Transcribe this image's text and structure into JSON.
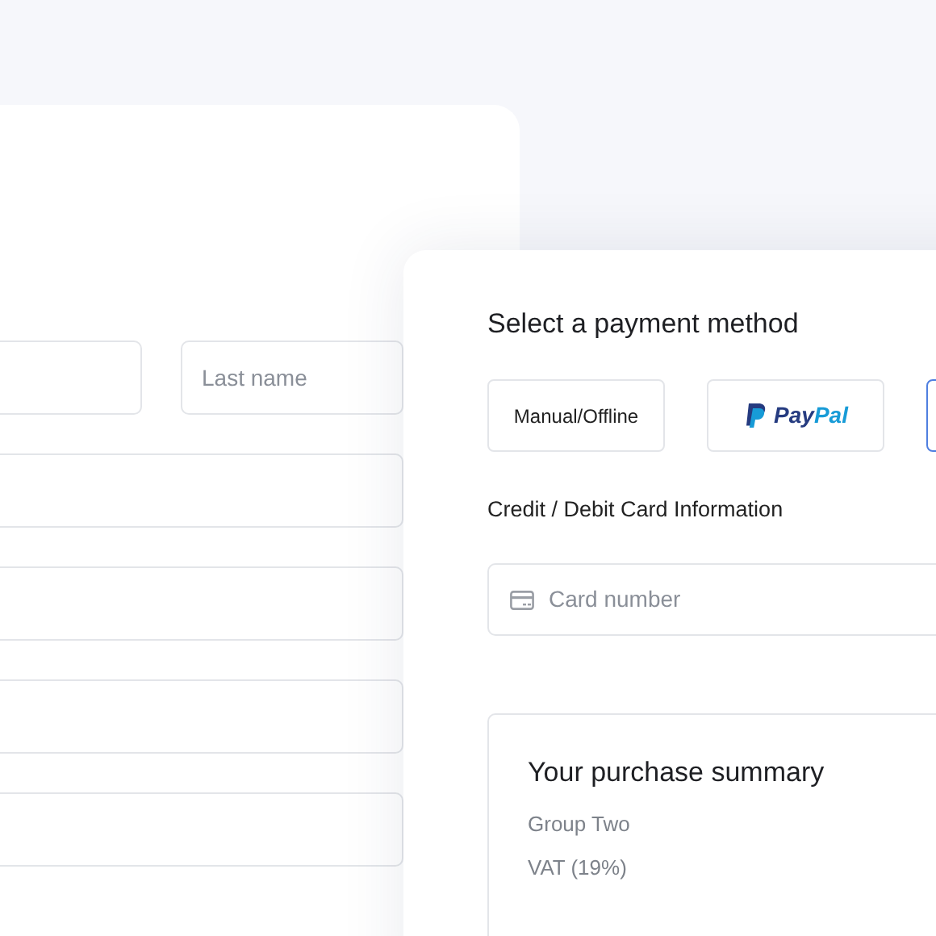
{
  "back_form": {
    "fields": [
      {
        "kind": "half"
      },
      {
        "kind": "half",
        "placeholder": "Last name"
      },
      {
        "kind": "full"
      },
      {
        "kind": "full"
      },
      {
        "kind": "full"
      },
      {
        "kind": "full"
      }
    ]
  },
  "payment": {
    "title": "Select a payment method",
    "methods": [
      {
        "kind": "text",
        "label": "Manual/Offline",
        "selected": false
      },
      {
        "kind": "paypal",
        "label": "PayPal",
        "selected": false
      },
      {
        "kind": "blank",
        "selected": true
      }
    ],
    "card_heading": "Credit / Debit Card Information",
    "card_field": {
      "placeholder": "Card number"
    },
    "summary": {
      "title": "Your purchase summary",
      "lines": [
        "Group Two",
        "VAT (19%)"
      ]
    }
  }
}
